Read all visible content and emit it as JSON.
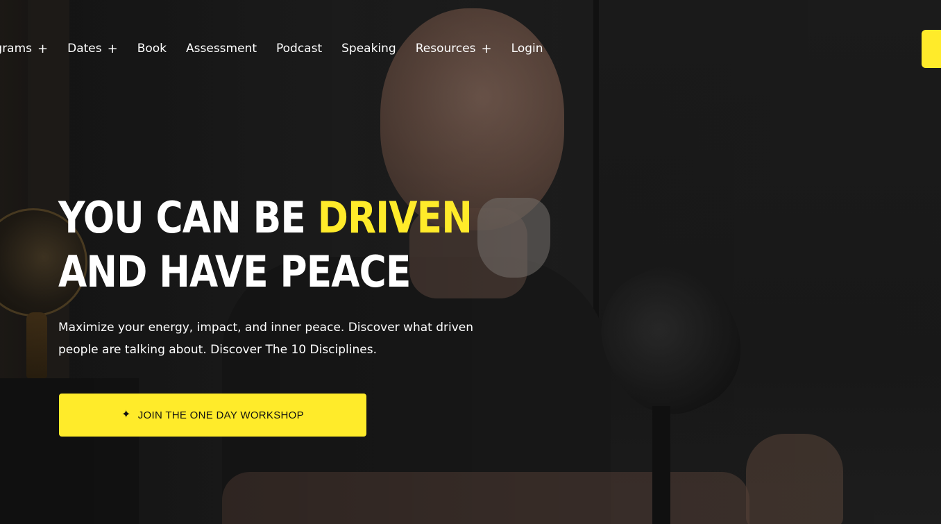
{
  "nav": {
    "items": [
      {
        "label": "ograms",
        "has_submenu": true,
        "submenu_icon": "+"
      },
      {
        "label": "Dates",
        "has_submenu": true,
        "submenu_icon": "+"
      },
      {
        "label": "Book",
        "has_submenu": false
      },
      {
        "label": "Assessment",
        "has_submenu": false
      },
      {
        "label": "Podcast",
        "has_submenu": false
      },
      {
        "label": "Speaking",
        "has_submenu": false
      },
      {
        "label": "Resources",
        "has_submenu": true,
        "submenu_icon": "+"
      },
      {
        "label": "Login",
        "has_submenu": false
      }
    ]
  },
  "hero": {
    "headline_line1_part1": "YOU CAN BE ",
    "headline_line1_accent": "DRIVEN",
    "headline_line2": "AND HAVE PEACE",
    "subtext": "Maximize your energy, impact, and inner peace. Discover what driven people are talking about. Discover The 10 Disciplines.",
    "cta_label": "JOIN THE ONE DAY WORKSHOP",
    "cta_icon": "sparkle-icon",
    "cta_icon_glyph": "✦"
  },
  "colors": {
    "accent": "#ffeb2a",
    "text": "#ffffff",
    "background": "#1d1d1d"
  }
}
